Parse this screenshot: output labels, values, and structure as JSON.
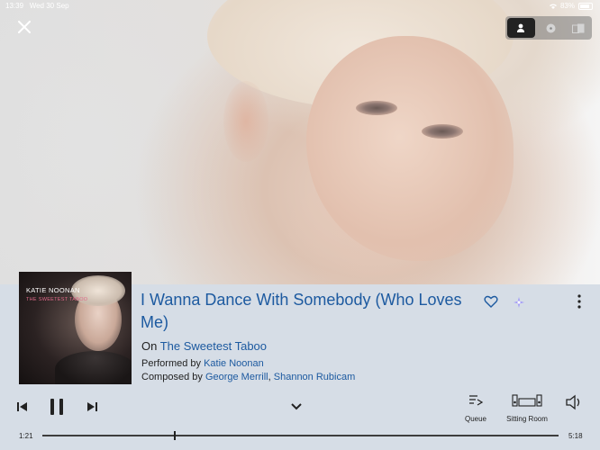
{
  "status_bar": {
    "time": "13:39",
    "date": "Wed 30 Sep",
    "battery": "83%"
  },
  "view_toggle": {
    "options": [
      "artist",
      "tracks",
      "album"
    ],
    "selected": "artist"
  },
  "track": {
    "title": "I Wanna Dance With Somebody (Who Loves Me)",
    "on_prefix": "On",
    "album": "The Sweetest Taboo",
    "performed_prefix": "Performed by",
    "performer": "Katie Noonan",
    "composed_prefix": "Composed by",
    "composer1": "George Merrill",
    "composer_separator": ",",
    "composer2": "Shannon Rubicam"
  },
  "album_art": {
    "artist_text": "KATIE NOONAN",
    "album_text": "THE SWEETEST TABOO"
  },
  "controls": {
    "queue_label": "Queue",
    "zone_label": "Sitting Room"
  },
  "playback": {
    "elapsed": "1:21",
    "duration": "5:18",
    "progress": 0.255
  },
  "colors": {
    "link": "#1d5aa0",
    "panel_bg": "#d6dde6",
    "accent_spark": "#8a7cff"
  }
}
